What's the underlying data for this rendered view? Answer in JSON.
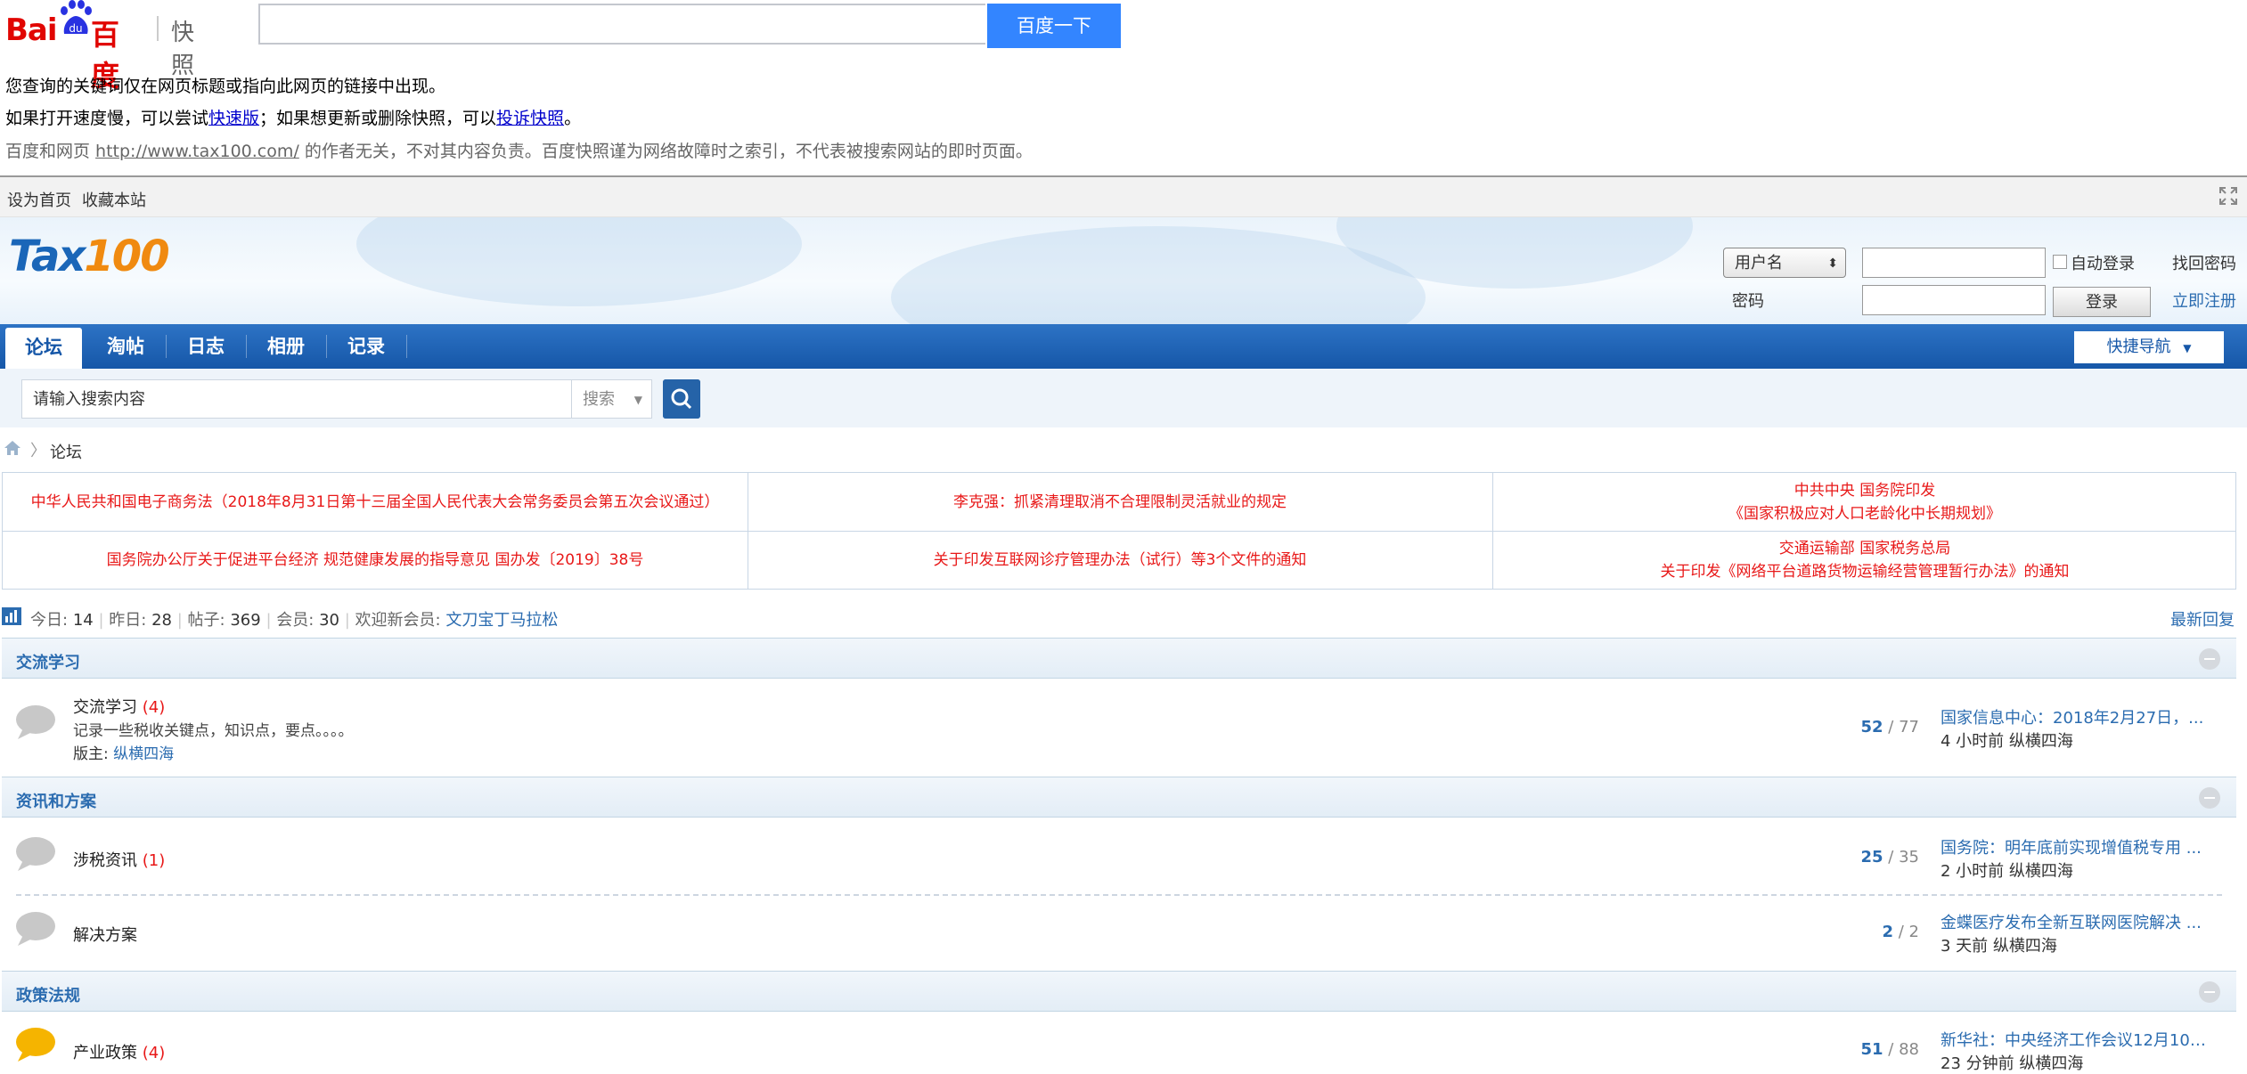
{
  "baidu": {
    "logo_bai": "Bai",
    "logo_du": "du",
    "logo_cn": "百度",
    "logo_snapshot": "快照",
    "search_button": "百度一下",
    "notice1": "您查询的关键词仅在网页标题或指向此网页的链接中出现。",
    "notice2_pre": "如果打开速度慢，可以尝试",
    "notice2_link1": "快速版",
    "notice2_mid": "；如果想更新或删除快照，可以",
    "notice2_link2": "投诉快照",
    "notice2_post": "。",
    "notice3_pre": "百度和网页 ",
    "notice3_url": "http://www.tax100.com/",
    "notice3_post": " 的作者无关，不对其内容负责。百度快照谨为网络故障时之索引，不代表被搜索网站的即时页面。"
  },
  "topbar": {
    "set_home": "设为首页",
    "bookmark": "收藏本站"
  },
  "header": {
    "logo_a": "Tax",
    "logo_b": "100",
    "username_select": "用户名",
    "password_label": "密码",
    "auto_login": "自动登录",
    "login_button": "登录",
    "forgot_password": "找回密码",
    "register": "立即注册"
  },
  "nav": {
    "items": [
      "论坛",
      "淘帖",
      "日志",
      "相册",
      "记录"
    ],
    "quick_nav": "快捷导航"
  },
  "search": {
    "placeholder": "请输入搜索内容",
    "type": "搜索"
  },
  "breadcrumb": {
    "current": "论坛"
  },
  "notices": [
    [
      "中华人民共和国电子商务法（2018年8月31日第十三届全国人民代表大会常务委员会第五次会议通过）"
    ],
    [
      "李克强：抓紧清理取消不合理限制灵活就业的规定"
    ],
    [
      "中共中央 国务院印发",
      "《国家积极应对人口老龄化中长期规划》"
    ],
    [
      "国务院办公厅关于促进平台经济 规范健康发展的指导意见 国办发〔2019〕38号"
    ],
    [
      "关于印发互联网诊疗管理办法（试行）等3个文件的通知"
    ],
    [
      "交通运输部 国家税务总局",
      "关于印发《网络平台道路货物运输经营管理暂行办法》的通知"
    ]
  ],
  "stats": {
    "today_label": "今日:",
    "today": "14",
    "yesterday_label": "昨日:",
    "yesterday": "28",
    "posts_label": "帖子:",
    "posts": "369",
    "members_label": "会员:",
    "members": "30",
    "welcome_label": "欢迎新会员:",
    "new_member": "文刀宝丁马拉松",
    "latest_reply": "最新回复"
  },
  "categories": [
    {
      "title": "交流学习",
      "forums": [
        {
          "name": "交流学习",
          "count": "(4)",
          "desc": "记录一些税收关键点，知识点，要点。。。。",
          "mod_label": "版主:",
          "mod": "纵横四海",
          "topics": "52",
          "sep": " / ",
          "posts": "77",
          "last_title": "国家信息中心：2018年2月27日，...",
          "last_meta": "4 小时前 纵横四海"
        }
      ]
    },
    {
      "title": "资讯和方案",
      "forums": [
        {
          "name": "涉税资讯",
          "count": "(1)",
          "topics": "25",
          "sep": " / ",
          "posts": "35",
          "last_title": "国务院：明年底前实现增值税专用 ...",
          "last_meta": "2 小时前 纵横四海"
        },
        {
          "name": "解决方案",
          "count": "",
          "topics": "2",
          "sep": " / ",
          "posts": "2",
          "last_title": "金蝶医疗发布全新互联网医院解决 ...",
          "last_meta": "3 天前 纵横四海"
        }
      ]
    },
    {
      "title": "政策法规",
      "forums": [
        {
          "name": "产业政策",
          "count": "(4)",
          "topics": "51",
          "sep": " / ",
          "posts": "88",
          "last_title": "新华社：中央经济工作会议12月10 ...",
          "last_meta": "23 分钟前 纵横四海"
        }
      ]
    }
  ],
  "colors": {
    "baidu_blue": "#3385ff",
    "baidu_red": "#e10602",
    "nav_blue": "#1657a8",
    "notice_red": "#e81818",
    "link_blue": "#2b6cb0"
  }
}
